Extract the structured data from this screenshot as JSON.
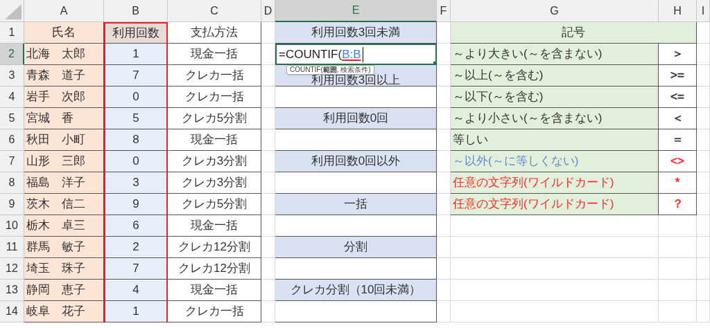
{
  "column_headers": [
    {
      "label": "A",
      "selected": false
    },
    {
      "label": "B",
      "selected": false
    },
    {
      "label": "C",
      "selected": false
    },
    {
      "label": "D",
      "selected": false
    },
    {
      "label": "E",
      "selected": true
    },
    {
      "label": "F",
      "selected": false
    },
    {
      "label": "G",
      "selected": false
    },
    {
      "label": "H",
      "selected": false
    },
    {
      "label": "I",
      "selected": false
    }
  ],
  "count_column_referenced": true,
  "rows": [
    {
      "number": "1",
      "selected": false,
      "name": "氏名",
      "count": "利用回数",
      "payment": "支払方法",
      "e": {
        "kind": "label",
        "text": "利用回数3回未満"
      },
      "g": {
        "kind": "title",
        "text": "記号"
      }
    },
    {
      "number": "2",
      "selected": true,
      "name": "北海　太郎",
      "count": "1",
      "payment": "現金一括",
      "e": {
        "kind": "formula",
        "prefix": "=COUNTIF(",
        "reference": "B:B"
      },
      "g": {
        "kind": "symbol",
        "meaning": {
          "text": "～より大きい(～を含まない)",
          "color": "#333333"
        },
        "symbol": {
          "text": "＞",
          "color": "#333333"
        }
      }
    },
    {
      "number": "3",
      "selected": false,
      "name": "青森　道子",
      "count": "7",
      "payment": "クレカ一括",
      "e": {
        "kind": "label",
        "text": "利用回数3回以上",
        "tooltip": "COUNTIF(**範囲**, 検索条件)"
      },
      "g": {
        "kind": "symbol",
        "meaning": {
          "text": "～以上(～を含む)",
          "color": "#333333"
        },
        "symbol": {
          "text": ">=",
          "color": "#333333"
        }
      }
    },
    {
      "number": "4",
      "selected": false,
      "name": "岩手　次郎",
      "count": "0",
      "payment": "クレカ一括",
      "e": {
        "kind": "blank"
      },
      "g": {
        "kind": "symbol",
        "meaning": {
          "text": "～以下(～を含む)",
          "color": "#333333"
        },
        "symbol": {
          "text": "<=",
          "color": "#333333"
        }
      }
    },
    {
      "number": "5",
      "selected": false,
      "name": "宮城　香",
      "count": "5",
      "payment": "クレカ5分割",
      "e": {
        "kind": "label",
        "text": "利用回数0回"
      },
      "g": {
        "kind": "symbol",
        "meaning": {
          "text": "～より小さい(～を含まない)",
          "color": "#333333"
        },
        "symbol": {
          "text": "＜",
          "color": "#333333"
        }
      }
    },
    {
      "number": "6",
      "selected": false,
      "name": "秋田　小町",
      "count": "8",
      "payment": "現金一括",
      "e": {
        "kind": "blank"
      },
      "g": {
        "kind": "symbol",
        "meaning": {
          "text": "等しい",
          "color": "#333333"
        },
        "symbol": {
          "text": "＝",
          "color": "#333333"
        }
      }
    },
    {
      "number": "7",
      "selected": false,
      "name": "山形　三郎",
      "count": "0",
      "payment": "クレカ3分割",
      "e": {
        "kind": "label",
        "text": "利用回数0回以外"
      },
      "g": {
        "kind": "symbol",
        "meaning": {
          "text": "～以外(～に等しくない)",
          "color": "#5b8bd6"
        },
        "symbol": {
          "text": "<>",
          "color": "#ff2a2a"
        }
      }
    },
    {
      "number": "8",
      "selected": false,
      "name": "福島　洋子",
      "count": "3",
      "payment": "クレカ3分割",
      "e": {
        "kind": "blank"
      },
      "g": {
        "kind": "symbol",
        "meaning": {
          "text": "任意の文字列(ワイルドカード)",
          "color": "#ff2a2a"
        },
        "symbol": {
          "text": "*",
          "color": "#ff2a2a"
        }
      }
    },
    {
      "number": "9",
      "selected": false,
      "name": "茨木　信二",
      "count": "9",
      "payment": "クレカ5分割",
      "e": {
        "kind": "label",
        "text": "一括"
      },
      "g": {
        "kind": "symbol",
        "meaning": {
          "text": "任意の文字列(ワイルドカード)",
          "color": "#ff2a2a"
        },
        "symbol": {
          "text": "？",
          "color": "#ff2a2a"
        }
      }
    },
    {
      "number": "10",
      "selected": false,
      "name": "栃木　卓三",
      "count": "6",
      "payment": "現金一括",
      "e": {
        "kind": "blank"
      },
      "g": {
        "kind": "none"
      }
    },
    {
      "number": "11",
      "selected": false,
      "name": "群馬　敏子",
      "count": "2",
      "payment": "クレカ12分割",
      "e": {
        "kind": "label",
        "text": "分割"
      },
      "g": {
        "kind": "none"
      }
    },
    {
      "number": "12",
      "selected": false,
      "name": "埼玉　珠子",
      "count": "7",
      "payment": "クレカ12分割",
      "e": {
        "kind": "blank"
      },
      "g": {
        "kind": "none"
      }
    },
    {
      "number": "13",
      "selected": false,
      "name": "静岡　恵子",
      "count": "4",
      "payment": "現金一括",
      "e": {
        "kind": "label",
        "text": "クレカ分割（10回未満）"
      },
      "g": {
        "kind": "none"
      }
    },
    {
      "number": "14",
      "selected": false,
      "name": "岐阜　花子",
      "count": "1",
      "payment": "クレカ一括",
      "e": {
        "kind": "blank"
      },
      "g": {
        "kind": "none"
      }
    }
  ]
}
